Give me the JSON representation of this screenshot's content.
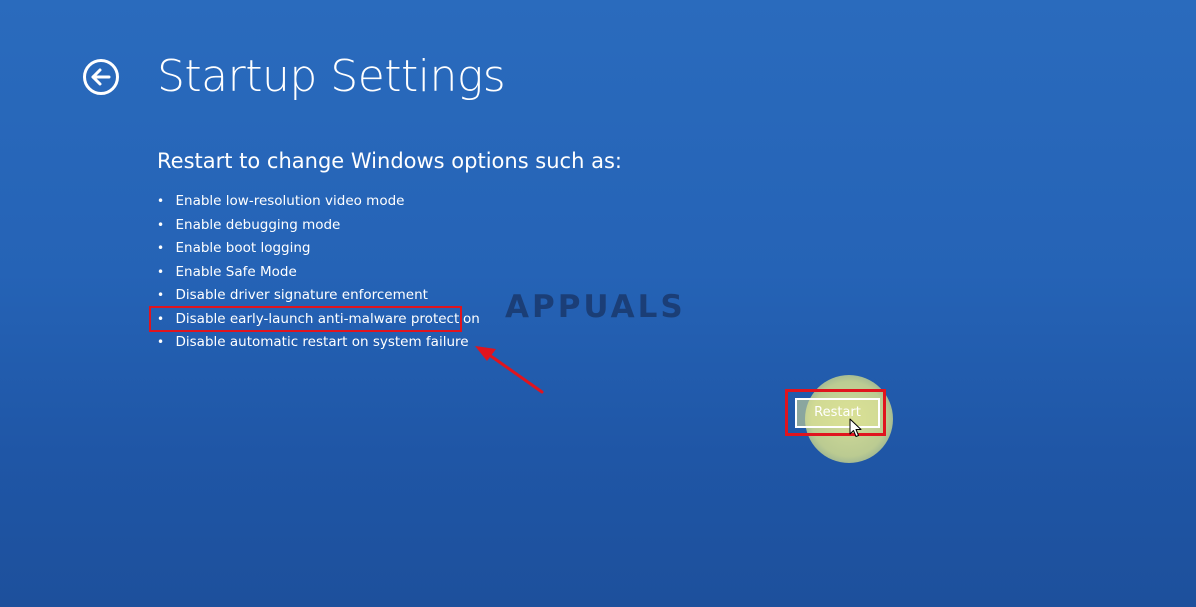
{
  "header": {
    "title": "Startup Settings",
    "back_icon": "back-arrow-circle-icon"
  },
  "main": {
    "subtitle": "Restart to change Windows options such as:",
    "options": [
      "Enable low-resolution video mode",
      "Enable debugging mode",
      "Enable boot logging",
      "Enable Safe Mode",
      "Disable driver signature enforcement",
      "Disable early-launch anti-malware protection",
      "Disable automatic restart on system failure"
    ],
    "highlighted_option_index": 5,
    "restart_label": "Restart"
  },
  "watermark": {
    "text": "APPUALS"
  },
  "colors": {
    "background": "#2563b6",
    "text": "#ffffff",
    "highlight": "#e0141e",
    "cursor_halo": "#e6eb98"
  }
}
